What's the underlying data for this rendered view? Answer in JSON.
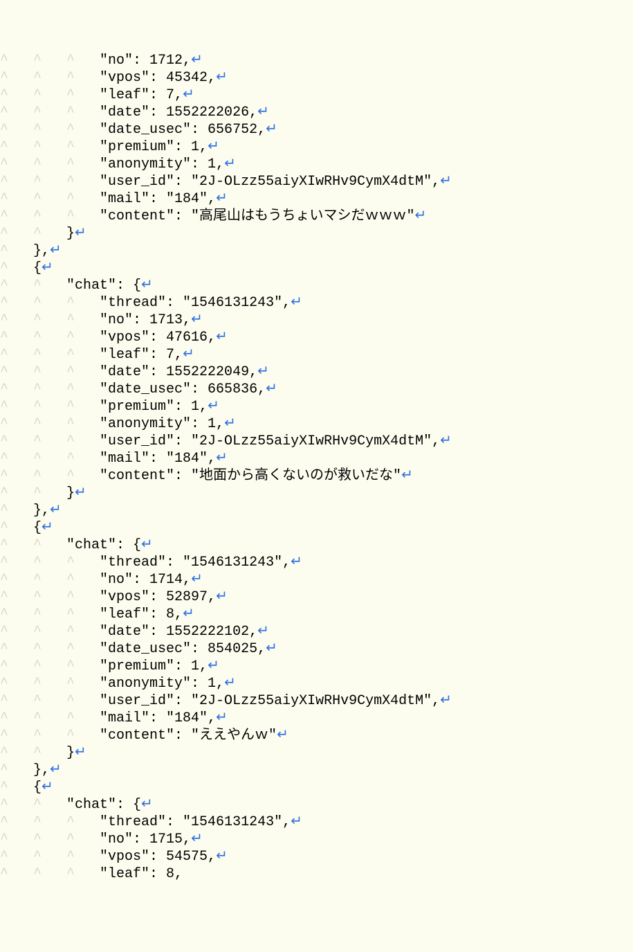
{
  "symbols": {
    "indent_glyph": "^",
    "crlf_glyph": "↵"
  },
  "lines": [
    {
      "indent": 3,
      "text": "\"no\": 1712,",
      "crlf": true
    },
    {
      "indent": 3,
      "text": "\"vpos\": 45342,",
      "crlf": true
    },
    {
      "indent": 3,
      "text": "\"leaf\": 7,",
      "crlf": true
    },
    {
      "indent": 3,
      "text": "\"date\": 1552222026,",
      "crlf": true
    },
    {
      "indent": 3,
      "text": "\"date_usec\": 656752,",
      "crlf": true
    },
    {
      "indent": 3,
      "text": "\"premium\": 1,",
      "crlf": true
    },
    {
      "indent": 3,
      "text": "\"anonymity\": 1,",
      "crlf": true
    },
    {
      "indent": 3,
      "text": "\"user_id\": \"2J-OLzz55aiyXIwRHv9CymX4dtM\",",
      "crlf": true
    },
    {
      "indent": 3,
      "text": "\"mail\": \"184\",",
      "crlf": true
    },
    {
      "indent": 3,
      "text": "\"content\": \"高尾山はもうちょいマシだｗｗｗ\"",
      "crlf": true
    },
    {
      "indent": 2,
      "text": "}",
      "crlf": true
    },
    {
      "indent": 1,
      "text": "},",
      "crlf": true
    },
    {
      "indent": 1,
      "text": "{",
      "crlf": true
    },
    {
      "indent": 2,
      "text": "\"chat\": {",
      "crlf": true
    },
    {
      "indent": 3,
      "text": "\"thread\": \"1546131243\",",
      "crlf": true
    },
    {
      "indent": 3,
      "text": "\"no\": 1713,",
      "crlf": true
    },
    {
      "indent": 3,
      "text": "\"vpos\": 47616,",
      "crlf": true
    },
    {
      "indent": 3,
      "text": "\"leaf\": 7,",
      "crlf": true
    },
    {
      "indent": 3,
      "text": "\"date\": 1552222049,",
      "crlf": true
    },
    {
      "indent": 3,
      "text": "\"date_usec\": 665836,",
      "crlf": true
    },
    {
      "indent": 3,
      "text": "\"premium\": 1,",
      "crlf": true
    },
    {
      "indent": 3,
      "text": "\"anonymity\": 1,",
      "crlf": true
    },
    {
      "indent": 3,
      "text": "\"user_id\": \"2J-OLzz55aiyXIwRHv9CymX4dtM\",",
      "crlf": true
    },
    {
      "indent": 3,
      "text": "\"mail\": \"184\",",
      "crlf": true
    },
    {
      "indent": 3,
      "text": "\"content\": \"地面から高くないのが救いだな\"",
      "crlf": true
    },
    {
      "indent": 2,
      "text": "}",
      "crlf": true
    },
    {
      "indent": 1,
      "text": "},",
      "crlf": true
    },
    {
      "indent": 1,
      "text": "{",
      "crlf": true
    },
    {
      "indent": 2,
      "text": "\"chat\": {",
      "crlf": true
    },
    {
      "indent": 3,
      "text": "\"thread\": \"1546131243\",",
      "crlf": true
    },
    {
      "indent": 3,
      "text": "\"no\": 1714,",
      "crlf": true
    },
    {
      "indent": 3,
      "text": "\"vpos\": 52897,",
      "crlf": true
    },
    {
      "indent": 3,
      "text": "\"leaf\": 8,",
      "crlf": true
    },
    {
      "indent": 3,
      "text": "\"date\": 1552222102,",
      "crlf": true
    },
    {
      "indent": 3,
      "text": "\"date_usec\": 854025,",
      "crlf": true
    },
    {
      "indent": 3,
      "text": "\"premium\": 1,",
      "crlf": true
    },
    {
      "indent": 3,
      "text": "\"anonymity\": 1,",
      "crlf": true
    },
    {
      "indent": 3,
      "text": "\"user_id\": \"2J-OLzz55aiyXIwRHv9CymX4dtM\",",
      "crlf": true
    },
    {
      "indent": 3,
      "text": "\"mail\": \"184\",",
      "crlf": true
    },
    {
      "indent": 3,
      "text": "\"content\": \"ええやんｗ\"",
      "crlf": true
    },
    {
      "indent": 2,
      "text": "}",
      "crlf": true
    },
    {
      "indent": 1,
      "text": "},",
      "crlf": true
    },
    {
      "indent": 1,
      "text": "{",
      "crlf": true
    },
    {
      "indent": 2,
      "text": "\"chat\": {",
      "crlf": true
    },
    {
      "indent": 3,
      "text": "\"thread\": \"1546131243\",",
      "crlf": true
    },
    {
      "indent": 3,
      "text": "\"no\": 1715,",
      "crlf": true
    },
    {
      "indent": 3,
      "text": "\"vpos\": 54575,",
      "crlf": true
    },
    {
      "indent": 3,
      "text": "\"leaf\": 8,",
      "crlf": false
    }
  ]
}
